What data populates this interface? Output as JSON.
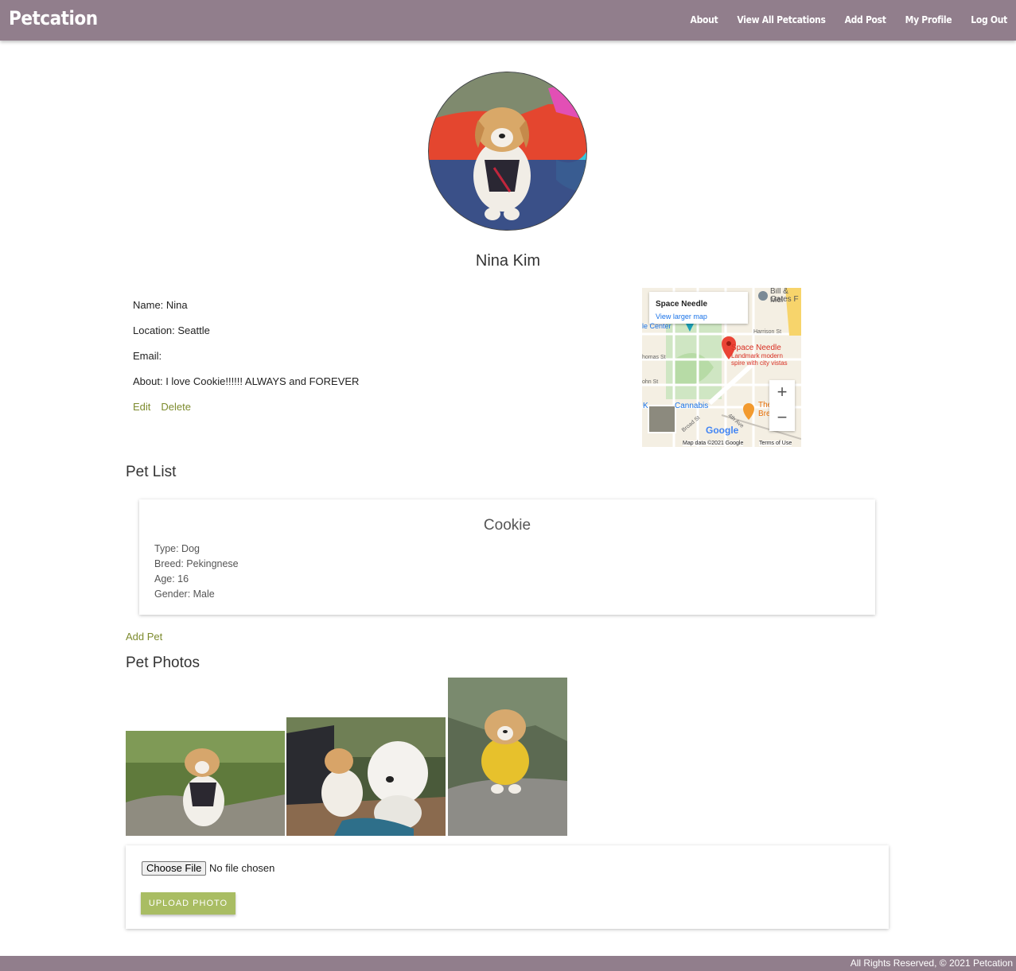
{
  "nav": {
    "brand": "Petcation",
    "links": [
      "About",
      "View All Petcations",
      "Add Post",
      "My Profile",
      "Log Out"
    ]
  },
  "profile": {
    "display_name": "Nina Kim",
    "name_line": "Name: Nina",
    "location_line": "Location: Seattle",
    "email_line": "Email:",
    "about_line": "About: I love Cookie!!!!!! ALWAYS and FOREVER",
    "edit_label": "Edit",
    "delete_label": "Delete"
  },
  "map": {
    "place_title": "Space Needle",
    "larger_map_link": "View larger map",
    "pin_label": "Space Needle",
    "pin_desc_1": "Landmark modern",
    "pin_desc_2": "spire with city vistas",
    "label_gates": "Bill & Mel",
    "label_gates2": "Gates F",
    "label_harrison": "Harrison St",
    "label_thomas": "homas St",
    "label_john": "ohn St",
    "label_center": "le Center",
    "label_cannabis": "Cannabis",
    "label_k": "K",
    "label_the": "The",
    "label_bre": "Bre",
    "label_broad": "Broad St",
    "label_4th": "4th Ave",
    "google": "Google",
    "map_data": "Map data ©2021 Google",
    "terms": "Terms of Use",
    "zoom_in": "+",
    "zoom_out": "−"
  },
  "pet_list": {
    "heading": "Pet List",
    "pets": [
      {
        "name": "Cookie",
        "type": "Type: Dog",
        "breed": "Breed: Pekingnese",
        "age": "Age: 16",
        "gender": "Gender: Male"
      }
    ],
    "add_pet_label": "Add Pet"
  },
  "photos": {
    "heading": "Pet Photos"
  },
  "upload": {
    "choose_file": "Choose File",
    "file_status": "No file chosen",
    "upload_label": "UPLOAD PHOTO"
  },
  "footer": {
    "text": "All Rights Reserved, © 2021 Petcation"
  },
  "colors": {
    "nav_bg": "#917e8c",
    "link": "#7d8b2e",
    "upload_btn": "#a9bd63"
  }
}
